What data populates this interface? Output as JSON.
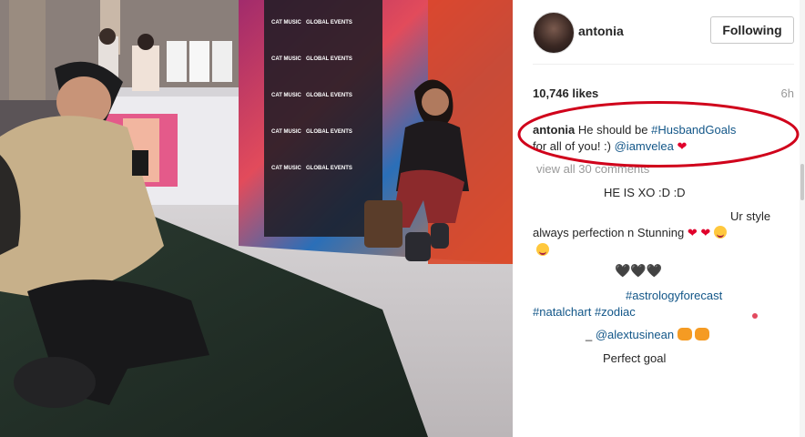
{
  "post": {
    "username": "antonia",
    "follow_label": "Following",
    "likes": "10,746 likes",
    "time": "6h",
    "caption": {
      "author": "antonia",
      "text1": "He should be",
      "hashtag": "#HusbandGoals",
      "text2": "for all of you! :)",
      "mention": "@iamvelea",
      "heart": "❤"
    },
    "view_all": "view all 30 comments"
  },
  "comments": [
    {
      "text": "HE IS XO :D :D"
    },
    {
      "text1": "Ur style",
      "text2": "always perfection n Stunning",
      "hearts": "❤ ❤"
    },
    {
      "text": "🖤🖤🖤"
    },
    {
      "tag1": "#astrologyforecast",
      "tag2": "#natalchart",
      "tag3": "#zodiac"
    },
    {
      "prefix": "_",
      "mention": "@alextusinean"
    },
    {
      "text": "Perfect goal"
    }
  ],
  "photo_text": {
    "backdrop_labels": [
      "CAT MUSIC",
      "GLOBAL EVENTS",
      "CAT MUSIC",
      "GLOBAL EVENTS",
      "CAT MUSIC",
      "GLOBAL EVENTS"
    ]
  },
  "colors": {
    "link": "#125688",
    "annotation_ellipse": "#d0021b",
    "heart": "#e0002b"
  }
}
